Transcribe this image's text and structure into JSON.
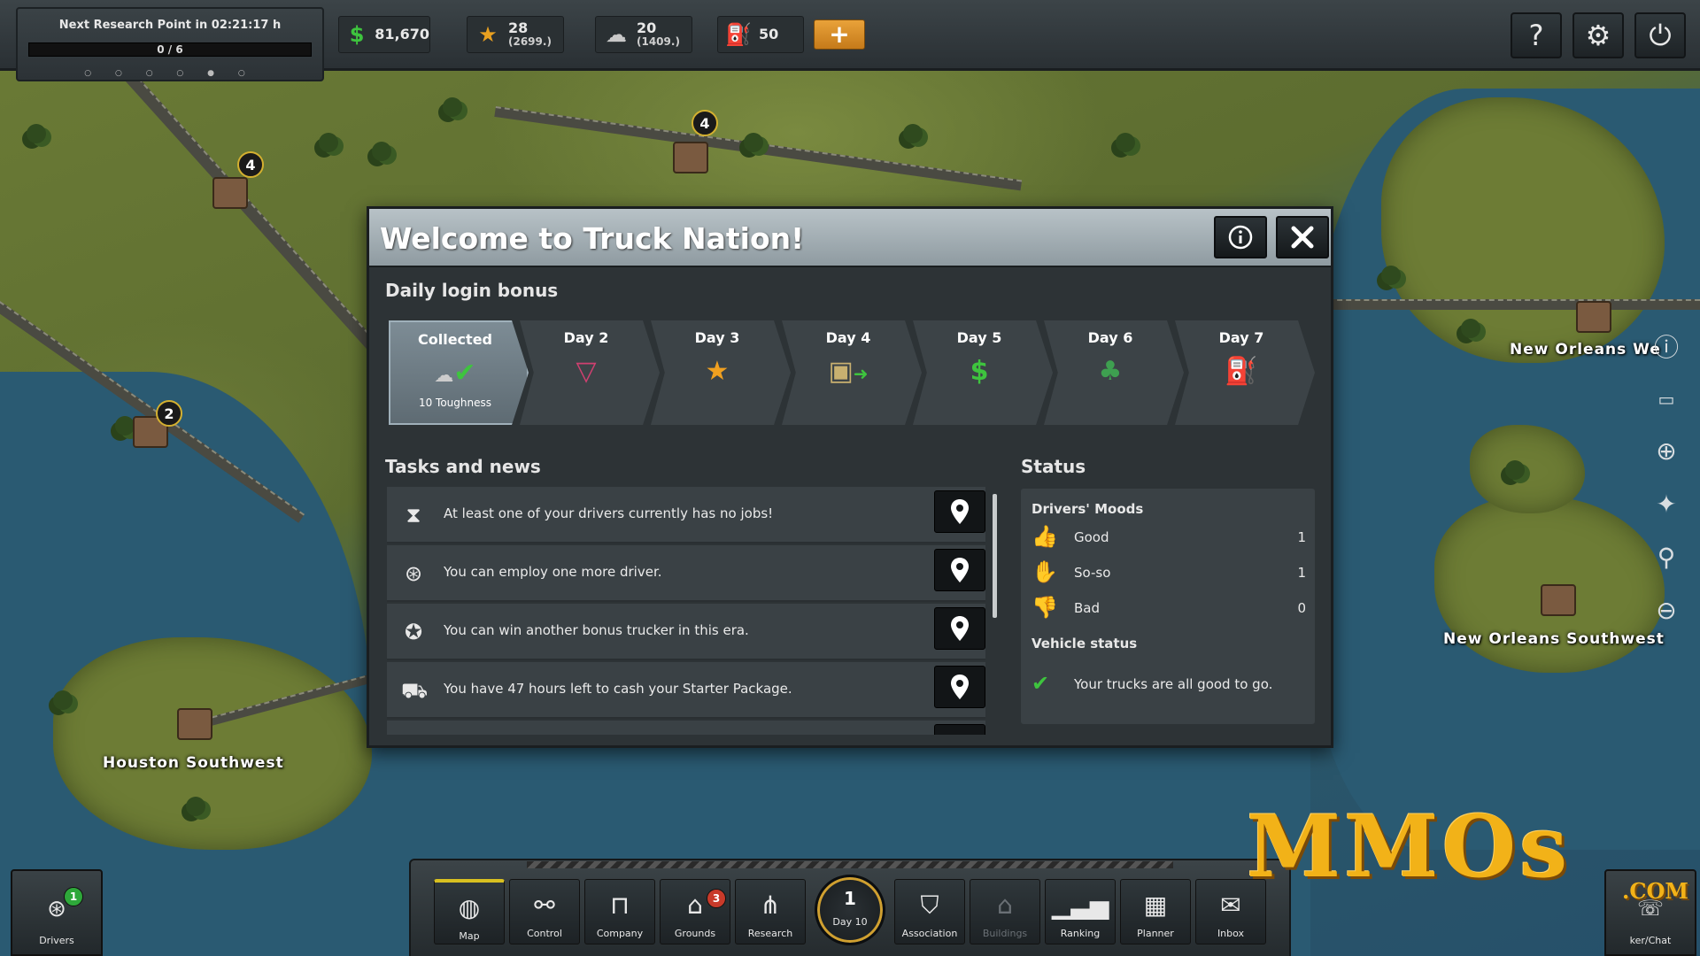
{
  "research": {
    "title": "Next Research Point in 02:21:17 h",
    "progress_text": "0 / 6",
    "progress_fraction": 0,
    "dots": "○ ○ ○ ○ ● ○"
  },
  "resources": {
    "money": "81,670",
    "stars": "28",
    "stars_sub": "(2699.)",
    "toughness": "20",
    "toughness_sub": "(1409.)",
    "fuel": "50"
  },
  "colors": {
    "accent_orange": "#d58a2a",
    "dialog_header": "#a7b2b8",
    "good": "#3ec43e",
    "bad": "#d63a2a",
    "badge": "#d4b030"
  },
  "map": {
    "labels": [
      "New Orleans We",
      "New Orleans Southwest",
      "Houston Southwest"
    ],
    "badges": [
      "4",
      "4",
      "2"
    ]
  },
  "dialog": {
    "title": "Welcome to Truck Nation!",
    "daily_title": "Daily login bonus",
    "days": [
      {
        "label": "Collected",
        "icon": "toughness-check-icon",
        "sub": "10 Toughness"
      },
      {
        "label": "Day 2",
        "icon": "gem-icon",
        "sub": ""
      },
      {
        "label": "Day 3",
        "icon": "star-icon",
        "sub": ""
      },
      {
        "label": "Day 4",
        "icon": "box-arrow-icon",
        "sub": ""
      },
      {
        "label": "Day 5",
        "icon": "dollar-icon",
        "sub": ""
      },
      {
        "label": "Day 6",
        "icon": "clover-card-icon",
        "sub": ""
      },
      {
        "label": "Day 7",
        "icon": "fuel-pump-icon",
        "sub": ""
      }
    ],
    "tasks_title": "Tasks and news",
    "tasks": [
      {
        "icon": "hourglass-icon",
        "text": "At least one of your drivers currently has no jobs!"
      },
      {
        "icon": "steering-wheel-icon",
        "text": "You can employ one more driver."
      },
      {
        "icon": "trucker-badge-icon",
        "text": "You can win another bonus trucker in this era."
      },
      {
        "icon": "truck-icon",
        "text": "You have 47 hours left to cash your Starter Package."
      }
    ],
    "status_title": "Status",
    "moods_title": "Drivers' Moods",
    "moods": [
      {
        "label": "Good",
        "value": "1"
      },
      {
        "label": "So-so",
        "value": "1"
      },
      {
        "label": "Bad",
        "value": "0"
      }
    ],
    "vehicle_title": "Vehicle status",
    "vehicle_text": "Your trucks are all good to go."
  },
  "bottom": {
    "drivers_label": "Drivers",
    "drivers_badge": "1",
    "nav": [
      {
        "label": "Map"
      },
      {
        "label": "Control"
      },
      {
        "label": "Company"
      },
      {
        "label": "Grounds",
        "badge": "3"
      },
      {
        "label": "Research"
      },
      {
        "label": "Association"
      },
      {
        "label": "Buildings"
      },
      {
        "label": "Ranking"
      },
      {
        "label": "Planner"
      },
      {
        "label": "Inbox"
      }
    ],
    "day_number": "1",
    "day_label": "Day 10",
    "chat_label": "ker/Chat"
  },
  "watermark": {
    "main": "MMOs",
    "suffix": ".COM"
  }
}
